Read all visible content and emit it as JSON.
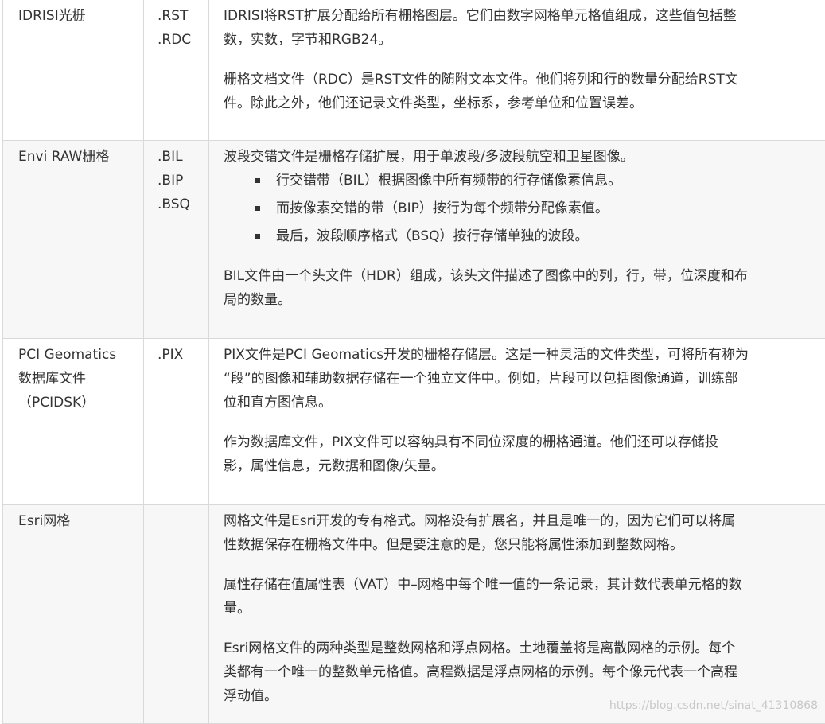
{
  "rows": [
    {
      "name_lines": [
        "IDRISI光栅"
      ],
      "ext_lines": [
        ".RST",
        ".RDC"
      ],
      "para1_lines": [
        "IDRISI将RST扩展分配给所有栅格图层。它们由数字网格单元格值组成，这些值包括整",
        "数，实数，字节和RGB24。"
      ],
      "para2_lines": [
        "栅格文档文件（RDC）是RST文件的随附文本文件。他们将列和行的数量分配给RST文",
        "件。除此之外，他们还记录文件类型，坐标系，参考单位和位置误差。"
      ]
    },
    {
      "name_lines": [
        "Envi RAW栅格"
      ],
      "ext_lines": [
        ".BIL",
        ".BIP",
        ".BSQ"
      ],
      "intro": "波段交错文件是栅格存储扩展，用于单波段/多波段航空和卫星图像。",
      "bullets": [
        "行交错带（BIL）根据图像中所有频带的行存储像素信息。",
        "而按像素交错的带（BIP）按行为每个频带分配像素值。",
        "最后，波段顺序格式（BSQ）按行存储单独的波段。"
      ],
      "para2_lines": [
        "BIL文件由一个头文件（HDR）组成，该头文件描述了图像中的列，行，带，位深度和布",
        "局的数量。"
      ]
    },
    {
      "name_lines": [
        "PCI Geomatics",
        "数据库文件",
        "（PCIDSK）"
      ],
      "ext_lines": [
        ".PIX"
      ],
      "para1_lines": [
        "PIX文件是PCI Geomatics开发的栅格存储层。这是一种灵活的文件类型，可将所有称为",
        "“段”的图像和辅助数据存储在一个独立文件中。例如，片段可以包括图像通道，训练部",
        "位和直方图信息。"
      ],
      "para2_lines": [
        "作为数据库文件，PIX文件可以容纳具有不同位深度的栅格通道。他们还可以存储投",
        "影，属性信息，元数据和图像/矢量。"
      ]
    },
    {
      "name_lines": [
        "Esri网格"
      ],
      "ext_lines": [],
      "para1_lines": [
        "网格文件是Esri开发的专有格式。网格没有扩展名，并且是唯一的，因为它们可以将属",
        "性数据保存在栅格文件中。但是要注意的是，您只能将属性添加到整数网格。"
      ],
      "para2_lines": [
        "属性存储在值属性表（VAT）中–网格中每个唯一值的一条记录，其计数代表单元格的数",
        "量。"
      ],
      "para3_lines": [
        "Esri网格文件的两种类型是整数网格和浮点网格。土地覆盖将是离散网格的示例。每个",
        "类都有一个唯一的整数单元格值。高程数据是浮点网格的示例。每个像元代表一个高程",
        "浮动值。"
      ]
    }
  ],
  "watermark": "https://blog.csdn.net/sinat_41310868"
}
